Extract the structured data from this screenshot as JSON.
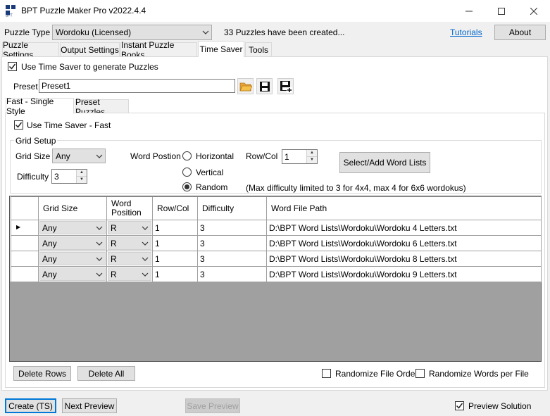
{
  "window": {
    "title": "BPT Puzzle Maker Pro v2022.4.4",
    "minimize_icon": "minimize-icon",
    "maximize_icon": "maximize-icon",
    "close_icon": "close-icon"
  },
  "header": {
    "puzzle_type_label": "Puzzle Type",
    "puzzle_type_value": "Wordoku (Licensed)",
    "puzzles_created": "33 Puzzles have been created...",
    "tutorials_link": "Tutorials",
    "about_button": "About"
  },
  "main_tabs": [
    {
      "label": "Puzzle Settings"
    },
    {
      "label": "Output Settings"
    },
    {
      "label": "Instant Puzzle Books"
    },
    {
      "label": "Time Saver"
    },
    {
      "label": "Tools"
    }
  ],
  "time_saver": {
    "use_time_saver_label": "Use Time Saver to generate Puzzles",
    "use_time_saver_checked": true,
    "preset_label": "Preset",
    "preset_value": "Preset1",
    "icons": [
      "folder-open-icon",
      "save-icon",
      "save-as-icon"
    ]
  },
  "sub_tabs": [
    {
      "label": "Fast - Single Style"
    },
    {
      "label": "Preset Puzzles"
    }
  ],
  "fast": {
    "use_fast_label": "Use Time Saver - Fast",
    "use_fast_checked": true,
    "grid_setup_label": "Grid Setup",
    "grid_size_label": "Grid Size",
    "grid_size_value": "Any",
    "difficulty_label": "Difficulty",
    "difficulty_value": "3",
    "word_position_label": "Word Postion",
    "radio_horizontal": "Horizontal",
    "radio_vertical": "Vertical",
    "radio_random": "Random",
    "selected_position": "Random",
    "rowcol_label": "Row/Col",
    "rowcol_value": "1",
    "select_word_lists_button": "Select/Add Word Lists",
    "note": "(Max difficulty limited to 3 for 4x4, max 4 for 6x6 wordokus)"
  },
  "table": {
    "headers": [
      "Grid Size",
      "Word Position",
      "Row/Col",
      "Difficulty",
      "Word File Path"
    ],
    "rows": [
      {
        "grid_size": "Any",
        "word_position": "R",
        "rowcol": "1",
        "difficulty": "3",
        "path": "D:\\BPT Word Lists\\Wordoku\\Wordoku 4 Letters.txt"
      },
      {
        "grid_size": "Any",
        "word_position": "R",
        "rowcol": "1",
        "difficulty": "3",
        "path": "D:\\BPT Word Lists\\Wordoku\\Wordoku 6 Letters.txt"
      },
      {
        "grid_size": "Any",
        "word_position": "R",
        "rowcol": "1",
        "difficulty": "3",
        "path": "D:\\BPT Word Lists\\Wordoku\\Wordoku 8 Letters.txt"
      },
      {
        "grid_size": "Any",
        "word_position": "R",
        "rowcol": "1",
        "difficulty": "3",
        "path": "D:\\BPT Word Lists\\Wordoku\\Wordoku 9 Letters.txt"
      }
    ]
  },
  "table_actions": {
    "delete_rows": "Delete Rows",
    "delete_all": "Delete All",
    "randomize_file_order": "Randomize File Order",
    "randomize_words": "Randomize Words per File"
  },
  "footer": {
    "create_button": "Create (TS)",
    "next_preview_button": "Next Preview",
    "save_preview_button": "Save Preview",
    "preview_solution_label": "Preview Solution",
    "preview_solution_checked": true
  },
  "colors": {
    "accent": "#0078d7",
    "link": "#0066cc",
    "folder": "#f5a623"
  }
}
